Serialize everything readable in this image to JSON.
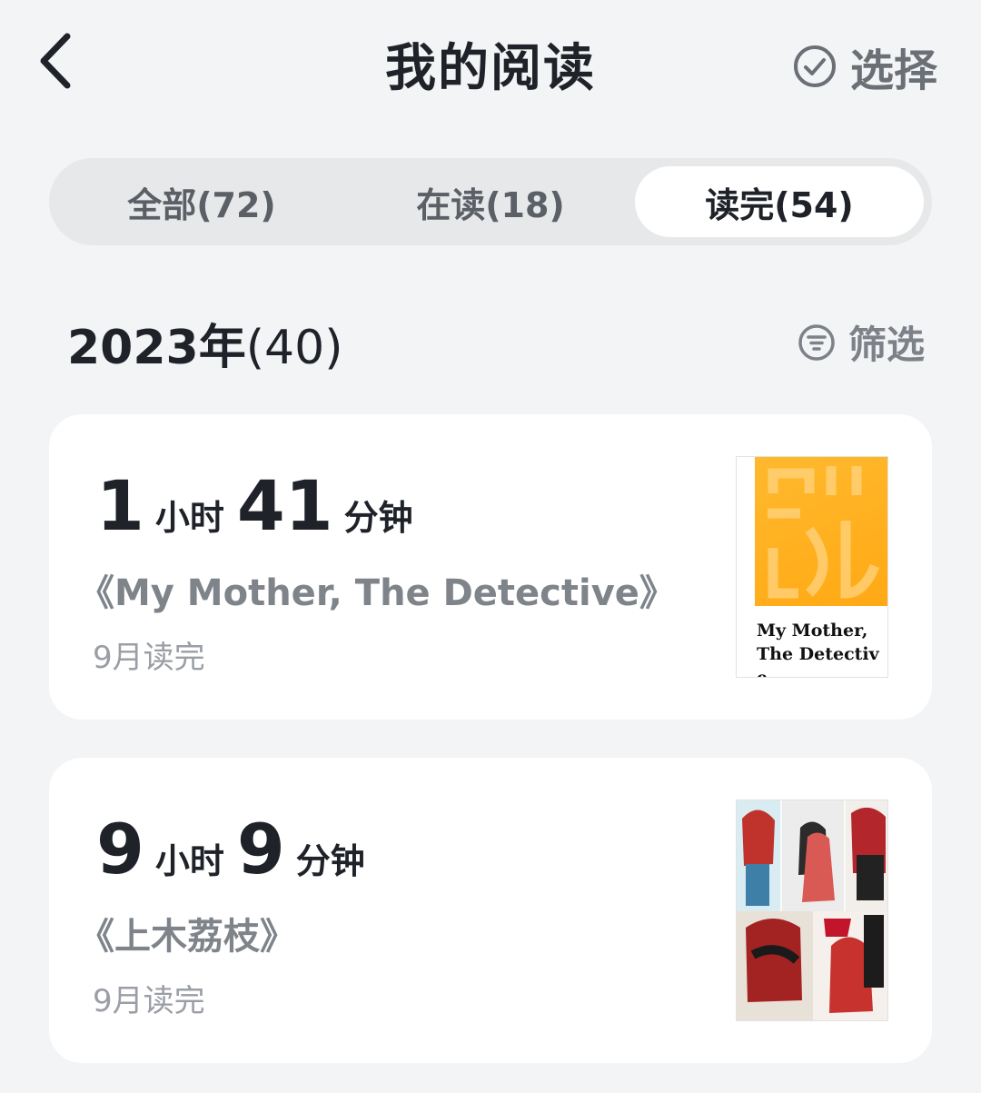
{
  "header": {
    "title": "我的阅读",
    "select_label": "选择"
  },
  "tabs": [
    {
      "label": "全部(72)",
      "active": false
    },
    {
      "label": "在读(18)",
      "active": false
    },
    {
      "label": "读完(54)",
      "active": true
    }
  ],
  "section": {
    "year": "2023年",
    "count": "(40)",
    "filter_label": "筛选"
  },
  "books": [
    {
      "hours": "1",
      "hours_unit": "小时",
      "minutes": "41",
      "minutes_unit": "分钟",
      "title": "《My Mother, The Detective》",
      "finished": "9月读完",
      "cover_text": "My Mother, The Detective"
    },
    {
      "hours": "9",
      "hours_unit": "小时",
      "minutes": "9",
      "minutes_unit": "分钟",
      "title": "《上木荔枝》",
      "finished": "9月读完"
    }
  ],
  "colors": {
    "background": "#f3f4f6",
    "card": "#ffffff",
    "cover_orange": "#ffb020"
  }
}
